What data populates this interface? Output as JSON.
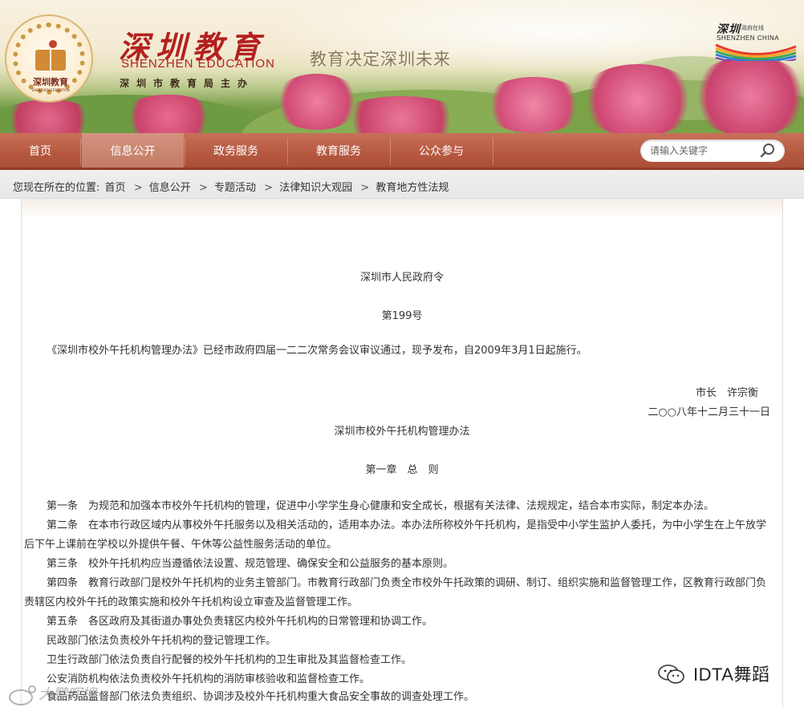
{
  "header": {
    "logo_text": "深圳教育",
    "logo_sub": "SHENZHEN EDUCATION",
    "title": "深圳教育",
    "title_en": "SHENZHEN EDUCATION",
    "host": "深圳市教育局主办",
    "slogan": "教育决定深圳未来",
    "brand_script": "深圳",
    "brand_tag": "政府在线",
    "brand_en": "SHENZHEN CHINA"
  },
  "nav": {
    "items": [
      {
        "label": "首页"
      },
      {
        "label": "信息公开"
      },
      {
        "label": "政务服务"
      },
      {
        "label": "教育服务"
      },
      {
        "label": "公众参与"
      }
    ],
    "active_index": 1,
    "search_placeholder": "请输入关键字"
  },
  "breadcrumb": {
    "prefix": "您现在所在的位置:",
    "items": [
      "首页",
      "信息公开",
      "专题活动",
      "法律知识大观园",
      "教育地方性法规"
    ]
  },
  "article": {
    "issuer": "深圳市人民政府令",
    "number": "第199号",
    "announcement": "《深圳市校外午托机构管理办法》已经市政府四届一二二次常务会议审议通过，现予发布，自2009年3月1日起施行。",
    "signer": "市长　许宗衡",
    "date": "二○○八年十二月三十一日",
    "doc_title": "深圳市校外午托机构管理办法",
    "chapter": "第一章　总　则",
    "paragraphs": [
      "第一条　为规范和加强本市校外午托机构的管理，促进中小学学生身心健康和安全成长，根据有关法律、法规规定，结合本市实际，制定本办法。",
      "第二条　在本市行政区域内从事校外午托服务以及相关活动的，适用本办法。本办法所称校外午托机构，是指受中小学生监护人委托，为中小学生在上午放学后下午上课前在学校以外提供午餐、午休等公益性服务活动的单位。",
      "第三条　校外午托机构应当遵循依法设置、规范管理、确保安全和公益服务的基本原则。",
      "第四条　教育行政部门是校外午托机构的业务主管部门。市教育行政部门负责全市校外午托政策的调研、制订、组织实施和监督管理工作，区教育行政部门负责辖区内校外午托的政策实施和校外午托机构设立审查及监督管理工作。",
      "第五条　各区政府及其街道办事处负责辖区内校外午托机构的日常管理和协调工作。",
      "民政部门依法负责校外午托机构的登记管理工作。",
      "卫生行政部门依法负责自行配餐的校外午托机构的卫生审批及其监督检查工作。",
      "公安消防机构依法负责校外午托机构的消防审核验收和监督检查工作。",
      "食品药品监督部门依法负责组织、协调涉及校外午托机构重大食品安全事故的调查处理工作。"
    ]
  },
  "watermark": {
    "text": "IDTA舞蹈",
    "secondary": "大鹏晖搜"
  },
  "colors": {
    "nav_bg": "#b65840",
    "title_red": "#b4201f",
    "text": "#333333"
  }
}
